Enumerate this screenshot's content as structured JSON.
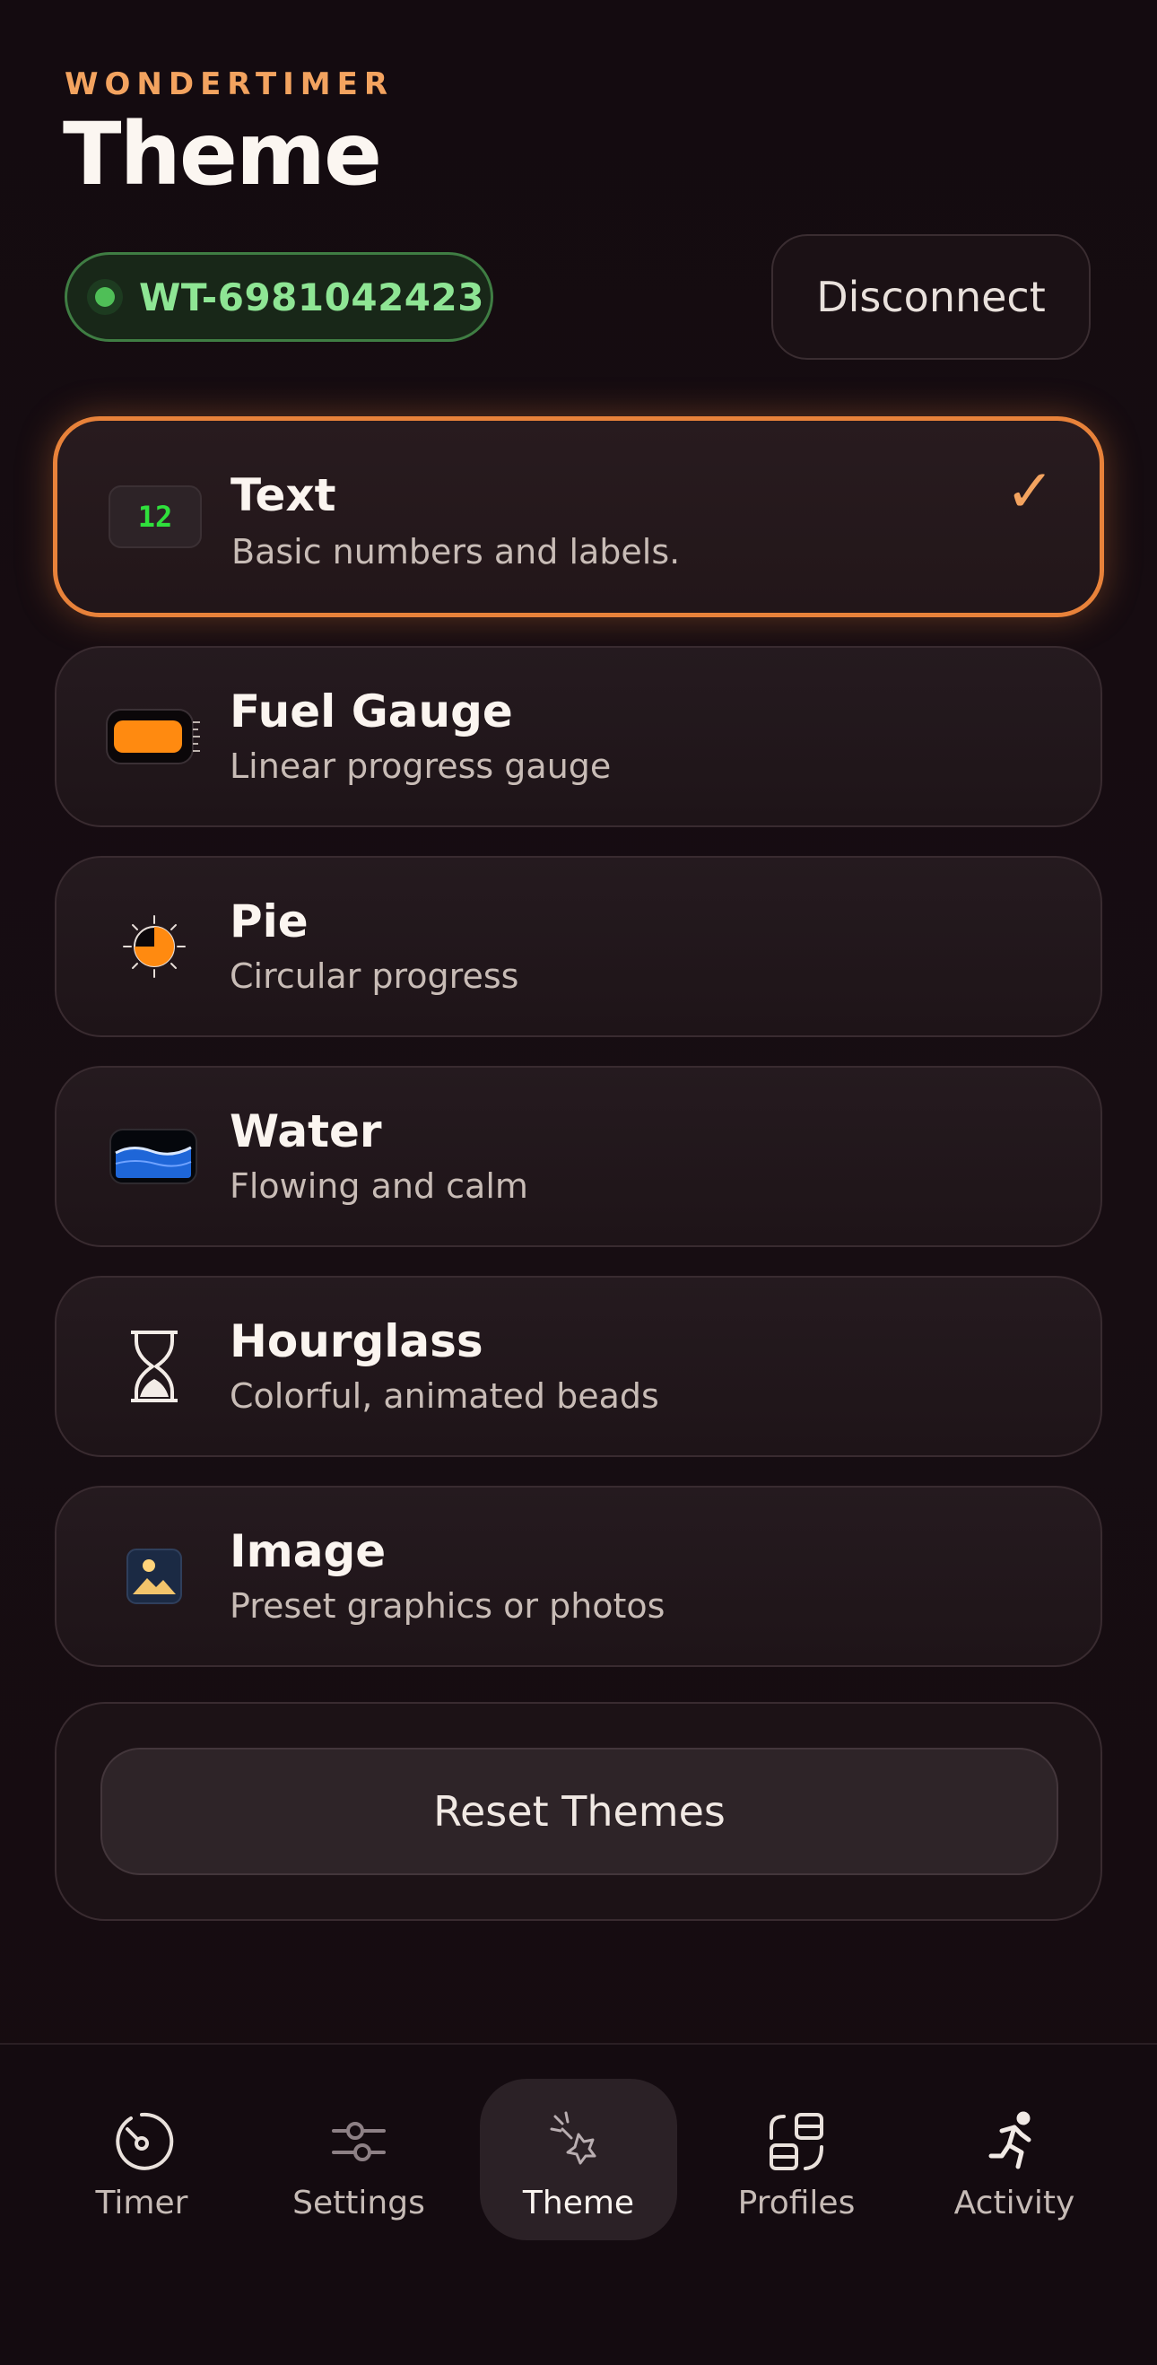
{
  "header": {
    "brand": "WONDERTIMER",
    "title": "Theme"
  },
  "device": {
    "id": "WT-6981042423",
    "status_color": "#4fbf57",
    "disconnect_label": "Disconnect"
  },
  "themes": [
    {
      "name": "Text",
      "description": "Basic numbers and labels.",
      "icon": "number-12-icon",
      "thumb_text": "12",
      "selected": true,
      "check": "✓"
    },
    {
      "name": "Fuel Gauge",
      "description": "Linear progress gauge",
      "icon": "battery-gauge-icon",
      "selected": false
    },
    {
      "name": "Pie",
      "description": "Circular progress",
      "icon": "pie-progress-icon",
      "selected": false
    },
    {
      "name": "Water",
      "description": "Flowing and calm",
      "icon": "water-wave-icon",
      "selected": false
    },
    {
      "name": "Hourglass",
      "description": "Colorful, animated beads",
      "icon": "hourglass-icon",
      "selected": false
    },
    {
      "name": "Image",
      "description": "Preset graphics or photos",
      "icon": "image-icon",
      "selected": false
    }
  ],
  "reset": {
    "label": "Reset Themes"
  },
  "tabs": [
    {
      "label": "Timer",
      "icon": "timer-icon",
      "active": false
    },
    {
      "label": "Settings",
      "icon": "sliders-icon",
      "active": false
    },
    {
      "label": "Theme",
      "icon": "theme-sparkle-icon",
      "active": true
    },
    {
      "label": "Profiles",
      "icon": "profiles-icon",
      "active": false
    },
    {
      "label": "Activity",
      "icon": "running-person-icon",
      "active": false
    }
  ],
  "colors": {
    "accent": "#e8823a",
    "brand_orange": "#f3a35f",
    "connected_green": "#8ee594",
    "background": "#140b10"
  }
}
